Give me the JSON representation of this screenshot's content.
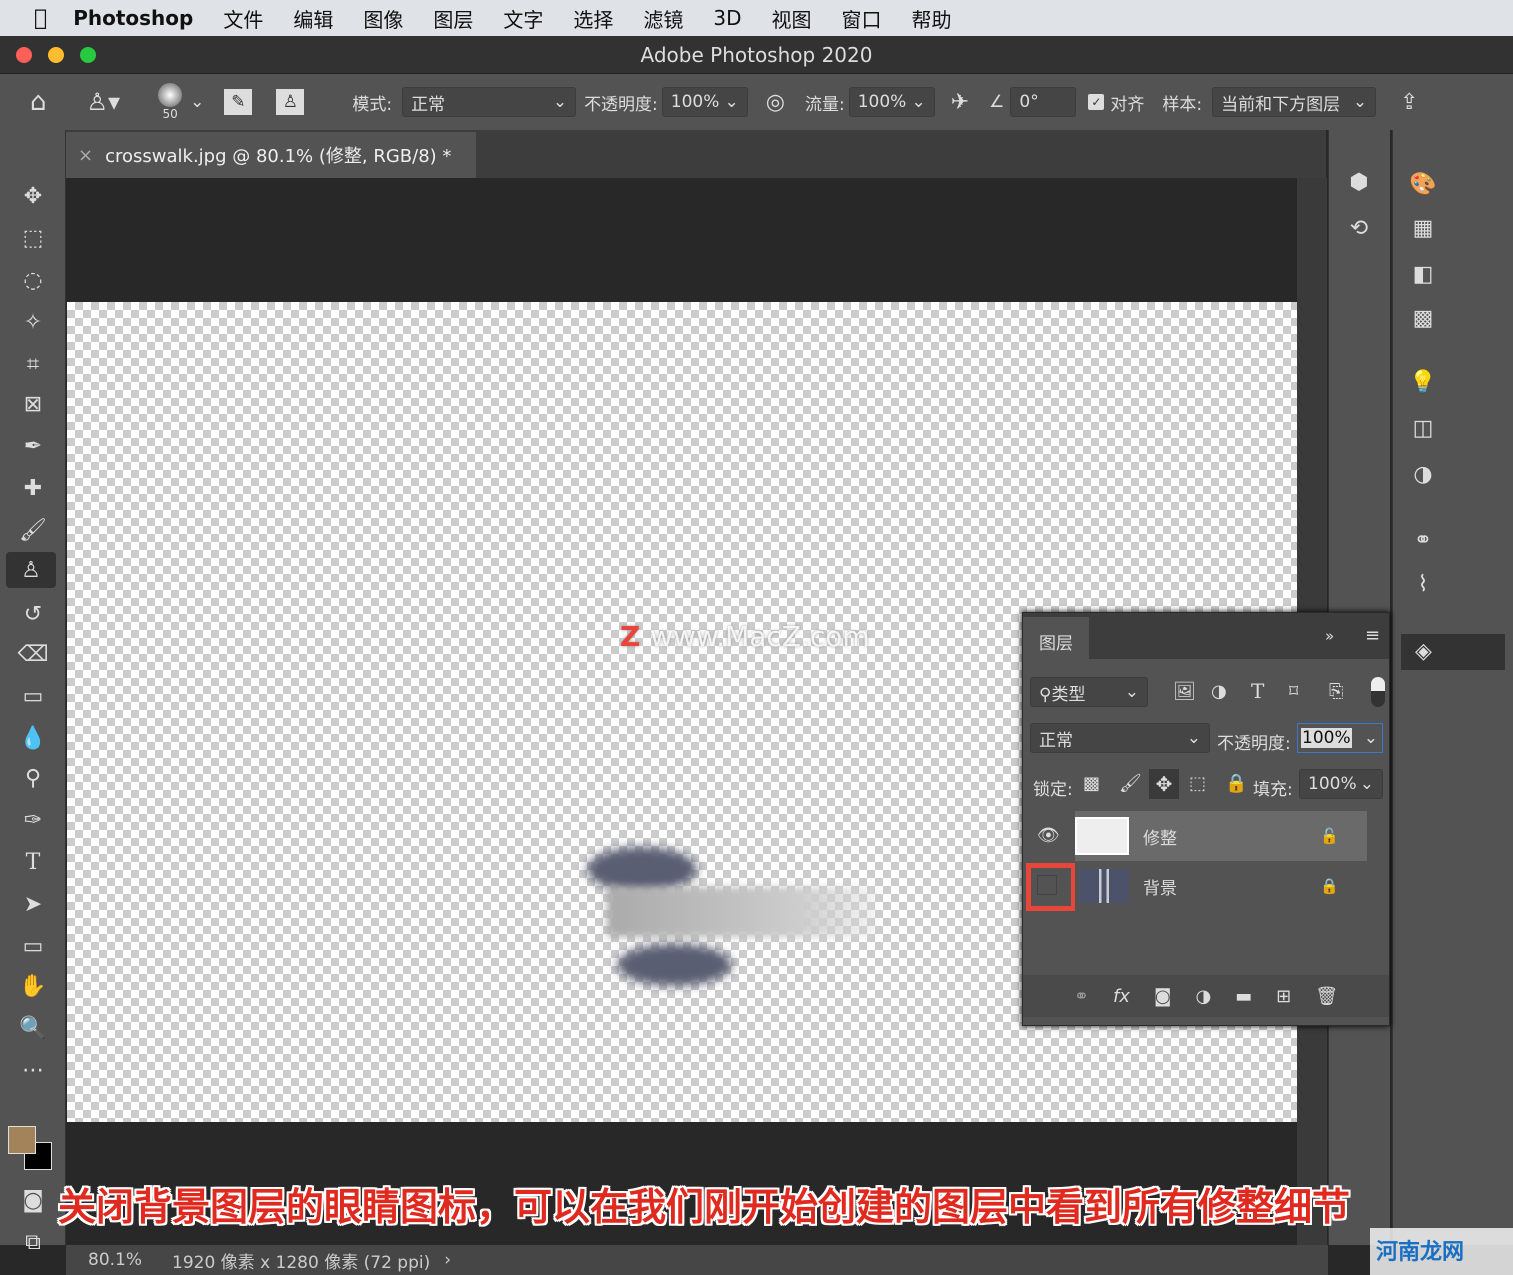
{
  "menubar": {
    "items": [
      "Photoshop",
      "文件",
      "编辑",
      "图像",
      "图层",
      "文字",
      "选择",
      "滤镜",
      "3D",
      "视图",
      "窗口",
      "帮助"
    ]
  },
  "window": {
    "title": "Adobe Photoshop 2020"
  },
  "options": {
    "brush_size": "50",
    "mode_label": "模式:",
    "mode_value": "正常",
    "opacity_label": "不透明度:",
    "opacity_value": "100%",
    "flow_label": "流量:",
    "flow_value": "100%",
    "angle_value": "0°",
    "align_label": "对齐",
    "align_checked": true,
    "sample_label": "样本:",
    "sample_value": "当前和下方图层"
  },
  "document": {
    "tab_title": "crosswalk.jpg @ 80.1% (修整, RGB/8) *"
  },
  "status": {
    "zoom": "80.1%",
    "info": "1920 像素 x 1280 像素 (72 ppi)"
  },
  "colors": {
    "foreground": "#a3835a",
    "background": "#000000",
    "highlight": "#e8463a"
  },
  "layers_panel": {
    "title": "图层",
    "filter_kind": "类型",
    "blend_mode": "正常",
    "opacity_label": "不透明度:",
    "opacity_value": "100%",
    "lock_label": "锁定:",
    "fill_label": "填充:",
    "fill_value": "100%",
    "layers": [
      {
        "name": "修整",
        "visible": true,
        "selected": true
      },
      {
        "name": "背景",
        "visible": false,
        "selected": false
      }
    ]
  },
  "watermark": "www.MacZ.com",
  "caption": "关闭背景图层的眼睛图标，可以在我们刚开始创建的图层中看到所有修整细节",
  "corner_logo": "河南龙网"
}
